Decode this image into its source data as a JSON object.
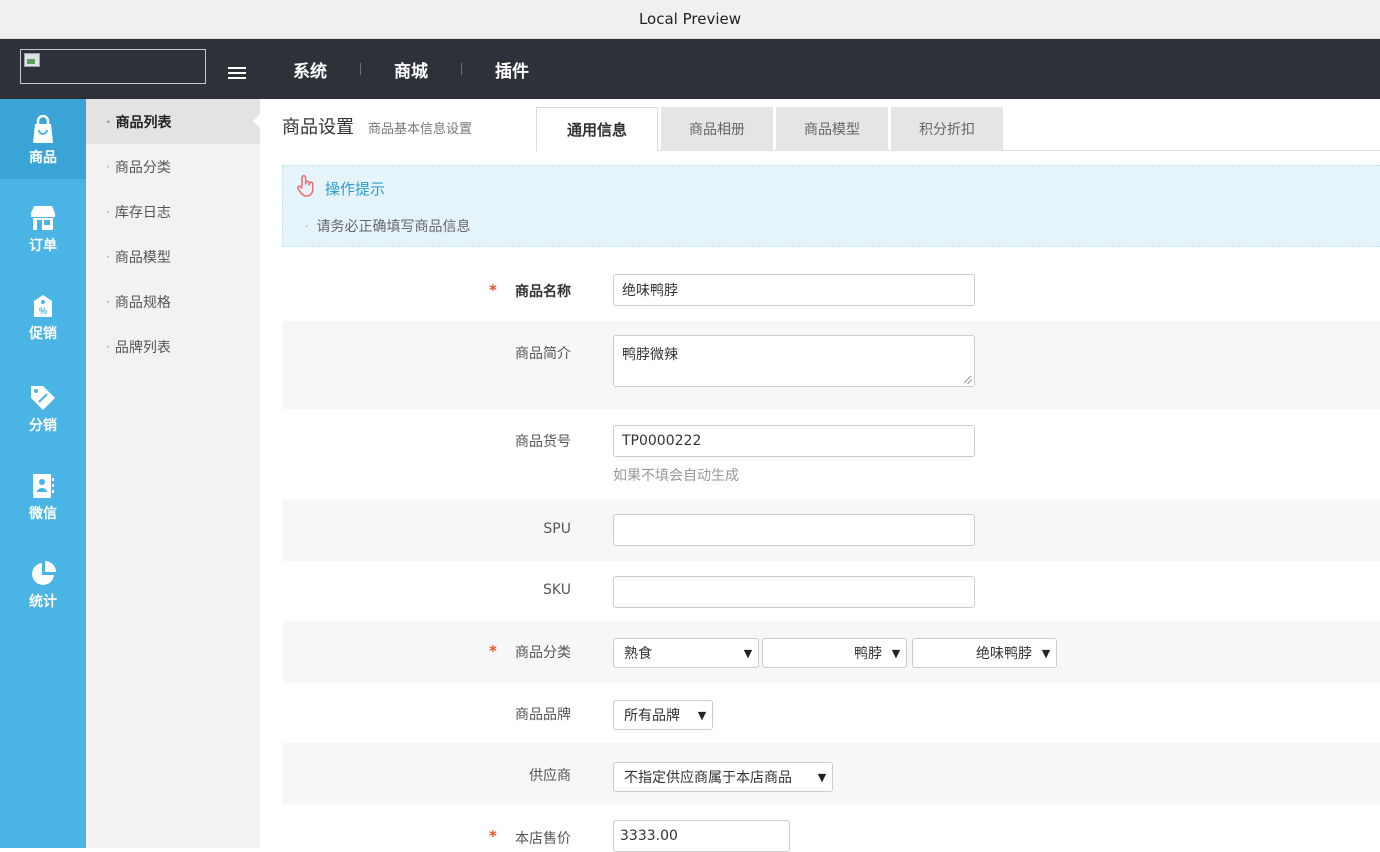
{
  "window": {
    "title": "Local Preview"
  },
  "topnav": {
    "items": [
      {
        "label": "系统"
      },
      {
        "label": "商城"
      },
      {
        "label": "插件"
      }
    ]
  },
  "iconbar": {
    "items": [
      {
        "label": "商品",
        "icon": "shopping-bag-icon"
      },
      {
        "label": "订单",
        "icon": "store-icon"
      },
      {
        "label": "促销",
        "icon": "promotion-icon"
      },
      {
        "label": "分销",
        "icon": "tag-icon"
      },
      {
        "label": "微信",
        "icon": "wechat-contact-icon"
      },
      {
        "label": "统计",
        "icon": "pie-chart-icon"
      }
    ],
    "accent_color": "#4ab4e4"
  },
  "submenu": {
    "items": [
      {
        "label": "商品列表"
      },
      {
        "label": "商品分类"
      },
      {
        "label": "库存日志"
      },
      {
        "label": "商品模型"
      },
      {
        "label": "商品规格"
      },
      {
        "label": "品牌列表"
      }
    ],
    "bullet": "·"
  },
  "page": {
    "title": "商品设置",
    "subtitle": "商品基本信息设置",
    "tabs": [
      {
        "label": "通用信息"
      },
      {
        "label": "商品相册"
      },
      {
        "label": "商品模型"
      },
      {
        "label": "积分折扣"
      }
    ]
  },
  "tip": {
    "title": "操作提示",
    "bullet": "·",
    "line": "请务必正确填写商品信息",
    "color": "#2a9ed4"
  },
  "form": {
    "required_mark": "*",
    "name": {
      "label": "商品名称",
      "value": "绝味鸭脖"
    },
    "intro": {
      "label": "商品简介",
      "value": "鸭脖微辣"
    },
    "sn": {
      "label": "商品货号",
      "value": "TP0000222",
      "help": "如果不填会自动生成"
    },
    "spu": {
      "label": "SPU",
      "value": ""
    },
    "sku": {
      "label": "SKU",
      "value": ""
    },
    "category": {
      "label": "商品分类",
      "level1": "熟食",
      "level2": "鸭脖",
      "level3": "绝味鸭脖"
    },
    "brand": {
      "label": "商品品牌",
      "value": "所有品牌"
    },
    "supplier": {
      "label": "供应商",
      "value": "不指定供应商属于本店商品"
    },
    "price": {
      "label": "本店售价",
      "value": "3333.00"
    },
    "caret": "▼"
  }
}
